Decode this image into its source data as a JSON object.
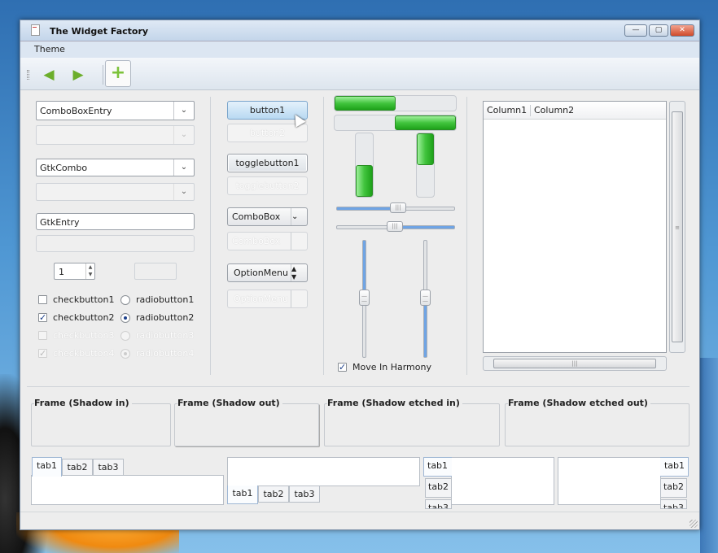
{
  "window": {
    "title": "The Widget Factory"
  },
  "menubar": {
    "items": [
      "Theme"
    ]
  },
  "toolbar": {
    "back_icon": "back-arrow-icon",
    "forward_icon": "forward-arrow-icon",
    "add_icon": "add-icon"
  },
  "col1": {
    "comboboxentry": "ComboBoxEntry",
    "gtkcombo": "GtkCombo",
    "gtkentry": "GtkEntry",
    "spin_value": "1",
    "checkbuttons": [
      "checkbutton1",
      "checkbutton2",
      "checkbutton3",
      "checkbutton4"
    ],
    "radiobuttons": [
      "radiobutton1",
      "radiobutton2",
      "radiobutton3",
      "radiobutton4"
    ]
  },
  "col2": {
    "button1": "button1",
    "button2": "button2",
    "togglebutton1": "togglebutton1",
    "togglebutton2": "togglebutton2",
    "combobox": "ComboBox",
    "combobox2": "ComboBox",
    "optionmenu": "OptionMenu",
    "optionmenu2": "OptionMenu"
  },
  "progress": {
    "h1": 0.5,
    "h2": 0.5,
    "v1": 0.5,
    "v2": 0.5
  },
  "scales": {
    "h1": 0.5,
    "h2": 0.5,
    "v1": 0.5,
    "v2": 0.5
  },
  "harmony_label": "Move In Harmony",
  "tree": {
    "columns": [
      "Column1",
      "Column2"
    ]
  },
  "frames": [
    "Frame (Shadow in)",
    "Frame (Shadow out)",
    "Frame (Shadow etched in)",
    "Frame (Shadow etched out)"
  ],
  "tabs": [
    "tab1",
    "tab2",
    "tab3"
  ],
  "window_buttons": {
    "minimize": "—",
    "maximize": "▢",
    "close": "✕"
  }
}
